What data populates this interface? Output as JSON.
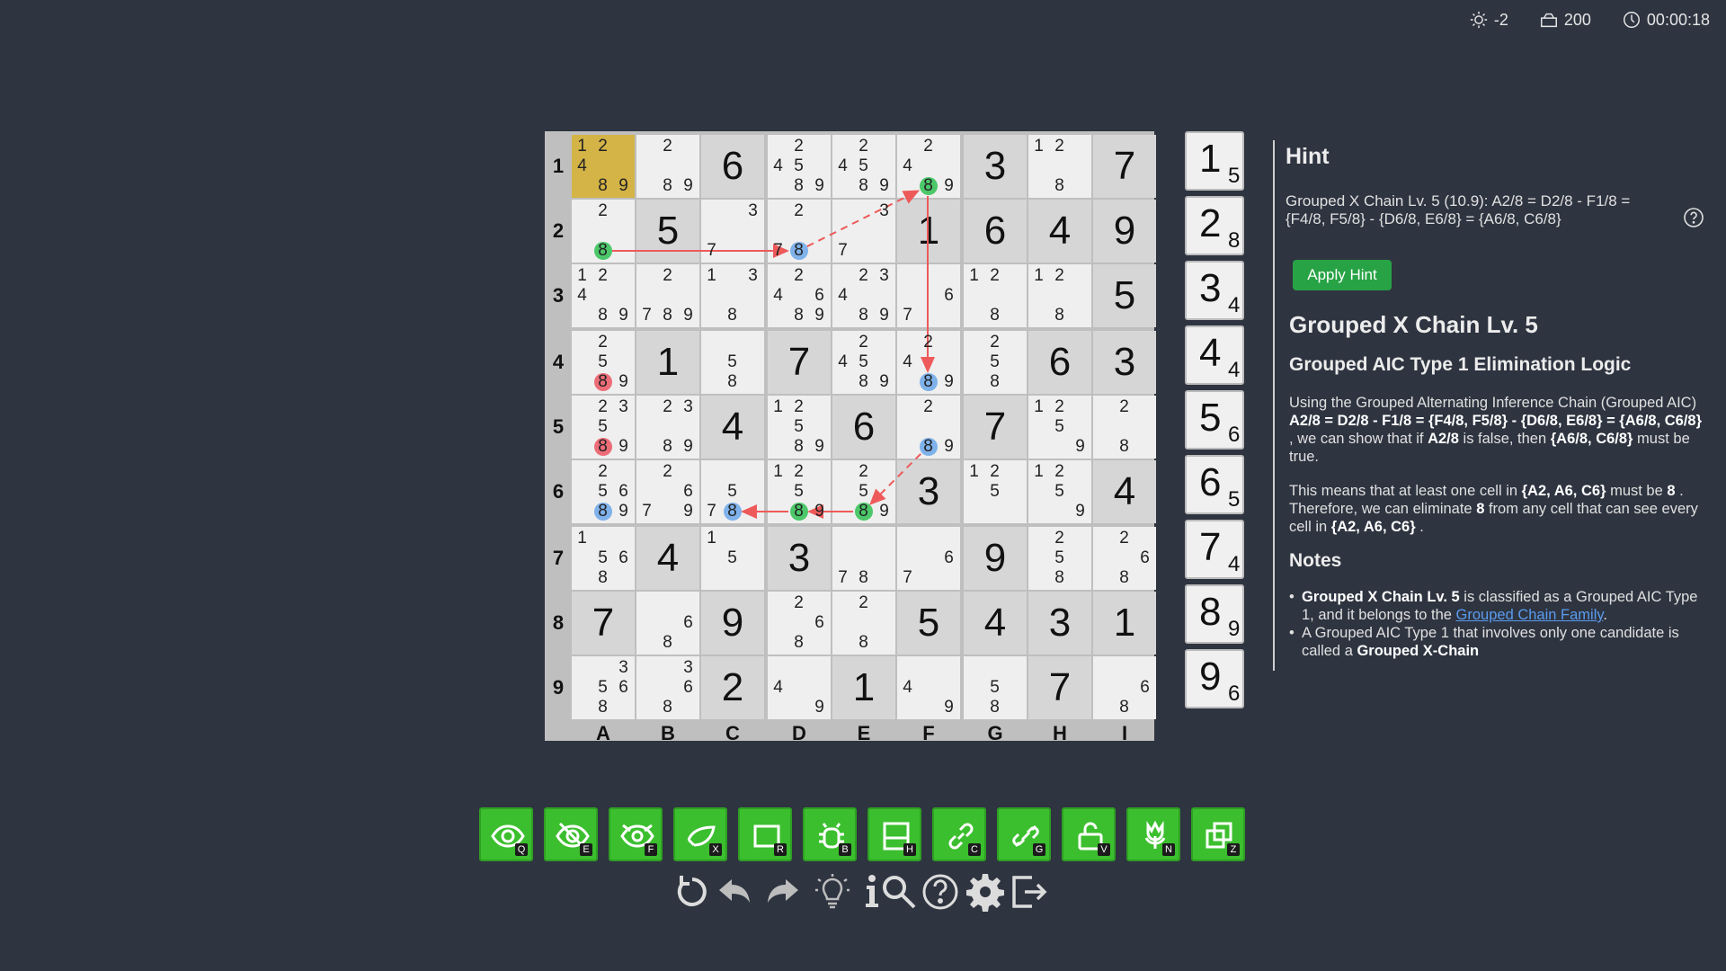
{
  "status": {
    "brightness": "-2",
    "score": "200",
    "timer": "00:00:18"
  },
  "board": {
    "row_labels": [
      "1",
      "2",
      "3",
      "4",
      "5",
      "6",
      "7",
      "8",
      "9"
    ],
    "col_labels": [
      "A",
      "B",
      "C",
      "D",
      "E",
      "F",
      "G",
      "H",
      "I"
    ],
    "cells": [
      [
        {
          "c": [
            "1",
            "2",
            "4",
            "8",
            "9"
          ],
          "hl": true
        },
        {
          "c": [
            "2",
            "8",
            "9"
          ]
        },
        {
          "v": "6",
          "g": true
        },
        {
          "c": [
            "2",
            "4",
            "5",
            "8",
            "9"
          ]
        },
        {
          "c": [
            "2",
            "4",
            "5",
            "8",
            "9"
          ]
        },
        {
          "c": [
            "2",
            "4",
            "8",
            "9"
          ],
          "dots": {
            "8": "green"
          }
        },
        {
          "v": "3",
          "g": true
        },
        {
          "c": [
            "1",
            "2",
            "8"
          ]
        },
        {
          "v": "7",
          "g": true
        }
      ],
      [
        {
          "c": [
            "2",
            "8"
          ],
          "dots": {
            "8": "green"
          }
        },
        {
          "v": "5",
          "g": true
        },
        {
          "c": [
            "3",
            "7"
          ]
        },
        {
          "c": [
            "2",
            "7",
            "8"
          ],
          "dots": {
            "8": "blue"
          }
        },
        {
          "c": [
            "3",
            "7"
          ]
        },
        {
          "v": "1",
          "g": true
        },
        {
          "v": "6",
          "g": true
        },
        {
          "v": "4",
          "g": true
        },
        {
          "v": "9",
          "g": true
        }
      ],
      [
        {
          "c": [
            "1",
            "2",
            "4",
            "8",
            "9"
          ]
        },
        {
          "c": [
            "2",
            "7",
            "8",
            "9"
          ]
        },
        {
          "c": [
            "1",
            "3",
            "8"
          ]
        },
        {
          "c": [
            "2",
            "4",
            "6",
            "8",
            "9"
          ]
        },
        {
          "c": [
            "2",
            "3",
            "4",
            "8",
            "9"
          ]
        },
        {
          "c": [
            "6",
            "7"
          ]
        },
        {
          "c": [
            "1",
            "2",
            "8"
          ]
        },
        {
          "c": [
            "1",
            "2",
            "8"
          ]
        },
        {
          "v": "5",
          "g": true
        }
      ],
      [
        {
          "c": [
            "2",
            "5",
            "8",
            "9"
          ],
          "dots": {
            "8": "red"
          }
        },
        {
          "v": "1",
          "g": true
        },
        {
          "c": [
            "5",
            "8"
          ]
        },
        {
          "v": "7",
          "g": true
        },
        {
          "c": [
            "2",
            "4",
            "5",
            "8",
            "9"
          ]
        },
        {
          "c": [
            "2",
            "4",
            "8",
            "9"
          ],
          "dots": {
            "8": "blue"
          }
        },
        {
          "c": [
            "2",
            "5",
            "8"
          ]
        },
        {
          "v": "6",
          "g": true
        },
        {
          "v": "3",
          "g": true
        }
      ],
      [
        {
          "c": [
            "2",
            "3",
            "5",
            "8",
            "9"
          ],
          "dots": {
            "8": "red"
          }
        },
        {
          "c": [
            "2",
            "3",
            "8",
            "9"
          ]
        },
        {
          "v": "4",
          "g": true
        },
        {
          "c": [
            "1",
            "2",
            "5",
            "8",
            "9"
          ]
        },
        {
          "v": "6",
          "g": true
        },
        {
          "c": [
            "2",
            "8",
            "9"
          ],
          "dots": {
            "8": "blue"
          }
        },
        {
          "v": "7",
          "g": true
        },
        {
          "c": [
            "1",
            "2",
            "5",
            "9"
          ]
        },
        {
          "c": [
            "2",
            "8"
          ]
        }
      ],
      [
        {
          "c": [
            "2",
            "5",
            "6",
            "8",
            "9"
          ],
          "dots": {
            "8": "blue"
          }
        },
        {
          "c": [
            "2",
            "6",
            "7",
            "9"
          ]
        },
        {
          "c": [
            "5",
            "7",
            "8"
          ],
          "dots": {
            "8": "blue"
          }
        },
        {
          "c": [
            "1",
            "2",
            "5",
            "8",
            "9"
          ],
          "dots": {
            "8": "green"
          }
        },
        {
          "c": [
            "2",
            "5",
            "8",
            "9"
          ],
          "dots": {
            "8": "green"
          }
        },
        {
          "v": "3",
          "g": true
        },
        {
          "c": [
            "1",
            "2",
            "5"
          ]
        },
        {
          "c": [
            "1",
            "2",
            "5",
            "9"
          ]
        },
        {
          "v": "4",
          "g": true
        }
      ],
      [
        {
          "c": [
            "1",
            "5",
            "6",
            "8"
          ]
        },
        {
          "v": "4",
          "g": true
        },
        {
          "c": [
            "1",
            "5"
          ]
        },
        {
          "v": "3",
          "g": true
        },
        {
          "c": [
            "7",
            "8"
          ]
        },
        {
          "c": [
            "6",
            "7"
          ]
        },
        {
          "v": "9",
          "g": true
        },
        {
          "c": [
            "2",
            "5",
            "8"
          ]
        },
        {
          "c": [
            "2",
            "6",
            "8"
          ]
        }
      ],
      [
        {
          "v": "7",
          "g": true
        },
        {
          "c": [
            "6",
            "8"
          ]
        },
        {
          "v": "9",
          "g": true
        },
        {
          "c": [
            "2",
            "6",
            "8"
          ]
        },
        {
          "c": [
            "2",
            "8"
          ]
        },
        {
          "v": "5",
          "g": true
        },
        {
          "v": "4",
          "g": true
        },
        {
          "v": "3",
          "g": true
        },
        {
          "v": "1",
          "g": true
        }
      ],
      [
        {
          "c": [
            "3",
            "5",
            "6",
            "8"
          ]
        },
        {
          "c": [
            "3",
            "6",
            "8"
          ]
        },
        {
          "v": "2",
          "g": true
        },
        {
          "c": [
            "4",
            "9"
          ]
        },
        {
          "v": "1",
          "g": true
        },
        {
          "c": [
            "4",
            "9"
          ]
        },
        {
          "c": [
            "5",
            "8"
          ]
        },
        {
          "v": "7",
          "g": true
        },
        {
          "c": [
            "6",
            "8"
          ]
        }
      ]
    ]
  },
  "digit_counts": [
    {
      "digit": "1",
      "count": "5"
    },
    {
      "digit": "2",
      "count": "8"
    },
    {
      "digit": "3",
      "count": "4"
    },
    {
      "digit": "4",
      "count": "4"
    },
    {
      "digit": "5",
      "count": "6"
    },
    {
      "digit": "6",
      "count": "5"
    },
    {
      "digit": "7",
      "count": "4"
    },
    {
      "digit": "8",
      "count": "9"
    },
    {
      "digit": "9",
      "count": "6"
    }
  ],
  "hint": {
    "title": "Hint",
    "summary": "Grouped X Chain Lv. 5 (10.9): A2/8 = D2/8 - F1/8 = {F4/8, F5/8} - {D6/8, E6/8} = {A6/8, C6/8}",
    "apply_label": "Apply Hint",
    "technique_title": "Grouped X Chain Lv. 5",
    "logic_title": "Grouped AIC Type 1 Elimination Logic",
    "p1_a": "Using the Grouped Alternating Inference Chain (Grouped AIC) ",
    "p1_b": "A2/8 = D2/8 - F1/8 = {F4/8, F5/8} - {D6/8, E6/8} = {A6/8, C6/8}",
    "p1_c": " , we can show that if ",
    "p1_d": "A2/8",
    "p1_e": " is false, then ",
    "p1_f": "{A6/8, C6/8}",
    "p1_g": " must be true.",
    "p2_a": "This means that at least one cell in ",
    "p2_b": "{A2, A6, C6}",
    "p2_c": " must be ",
    "p2_d": "8",
    "p2_e": " . Therefore, we can eliminate ",
    "p2_f": "8",
    "p2_g": " from any cell that can see every cell in ",
    "p2_h": "{A2, A6, C6}",
    "p2_i": " .",
    "notes_title": "Notes",
    "n1_a": "Grouped X Chain Lv. 5",
    "n1_b": " is classified as a Grouped AIC Type 1, and it belongs to the ",
    "n1_link": "Grouped Chain Family",
    "n1_c": ".",
    "n2_a": "A Grouped AIC Type 1 that involves only one candidate is called a ",
    "n2_b": "Grouped X-Chain"
  },
  "toolbar_keys": [
    "Q",
    "E",
    "F",
    "X",
    "R",
    "B",
    "H",
    "C",
    "G",
    "V",
    "N",
    "Z"
  ],
  "colors": {
    "background": "#2e3440",
    "tool_green": "#3bbf2e",
    "highlight": "#d4b446",
    "dot_green": "#4cc86a",
    "dot_blue": "#7fb2ea",
    "dot_red": "#ec6d78",
    "chain": "#ee5a5a"
  }
}
